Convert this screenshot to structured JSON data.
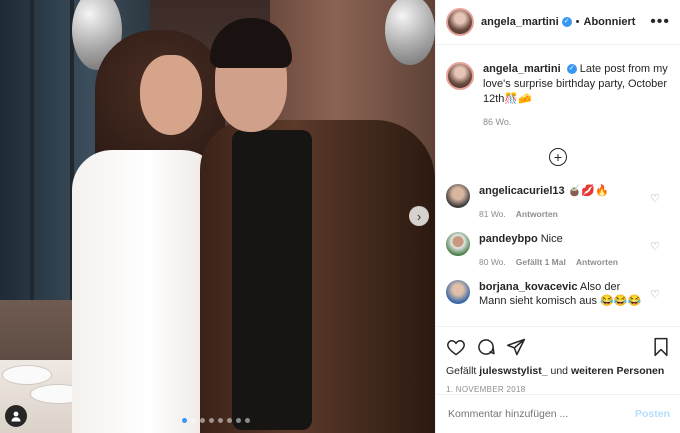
{
  "post": {
    "username": "angela_martini",
    "follow_label": "Abonniert",
    "separator": "•",
    "more_label": "•••",
    "photo": {
      "carousel_dots": 8,
      "active_index": 0,
      "next_label": "›"
    }
  },
  "caption": {
    "username": "angela_martini",
    "text": "Late post from my love's surprise birthday party, October 12th🎊🧀",
    "age": "86 Wo."
  },
  "load_more_label": "+",
  "comments": [
    {
      "username": "angelicacuriel13",
      "text": "🧉💋🔥",
      "age": "81 Wo.",
      "likes": "",
      "reply_label": "Antworten"
    },
    {
      "username": "pandeybpo",
      "text": "Nice",
      "age": "80 Wo.",
      "likes": "Gefällt 1 Mal",
      "reply_label": "Antworten"
    },
    {
      "username": "borjana_kovacevic",
      "text": "Also der Mann sieht komisch aus 😂😂😂",
      "age": "",
      "likes": "",
      "reply_label": ""
    }
  ],
  "likes_line": {
    "prefix": "Gefällt",
    "user": "juleswstylist_",
    "connector": "und",
    "others": "weiteren Personen"
  },
  "date": "1. NOVEMBER 2018",
  "add_comment": {
    "placeholder": "Kommentar hinzufügen ...",
    "post_label": "Posten"
  },
  "colors": {
    "accent": "#3897f0",
    "post_disabled": "#b2dffc",
    "muted": "#8e8e8e"
  },
  "icons": [
    "heart-icon",
    "comment-icon",
    "share-icon",
    "bookmark-icon",
    "plus-circle-icon",
    "more-icon",
    "verified-icon",
    "tag-user-icon",
    "chevron-right-icon"
  ]
}
